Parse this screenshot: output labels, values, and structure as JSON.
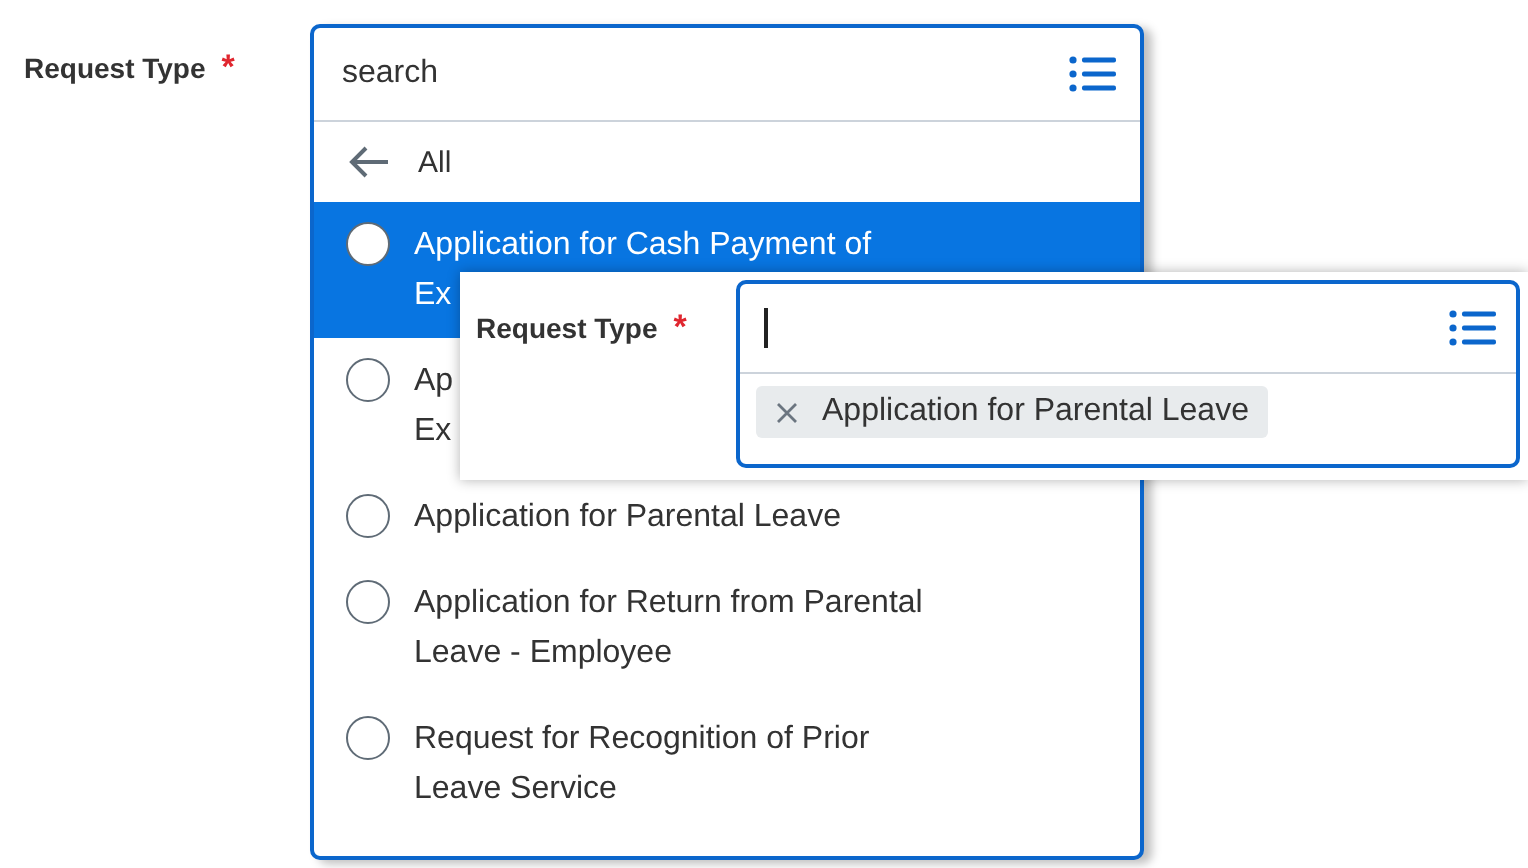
{
  "form": {
    "label": "Request Type",
    "required_mark": "*"
  },
  "dropdown": {
    "search": {
      "value": "search"
    },
    "back": {
      "label": "All"
    },
    "options": [
      {
        "lines": [
          "Application for Cash Payment of",
          "Ex"
        ],
        "selected": true
      },
      {
        "lines": [
          "Ap",
          "Ex"
        ],
        "selected": false
      },
      {
        "lines": [
          "Application for Parental Leave"
        ],
        "selected": false
      },
      {
        "lines": [
          "Application for Return from Parental",
          "Leave - Employee"
        ],
        "selected": false
      },
      {
        "lines": [
          "Request for Recognition of Prior",
          "Leave Service"
        ],
        "selected": false
      }
    ]
  },
  "overlay": {
    "label": "Request Type",
    "required_mark": "*",
    "chips": [
      {
        "label": "Application for Parental Leave"
      }
    ]
  }
}
